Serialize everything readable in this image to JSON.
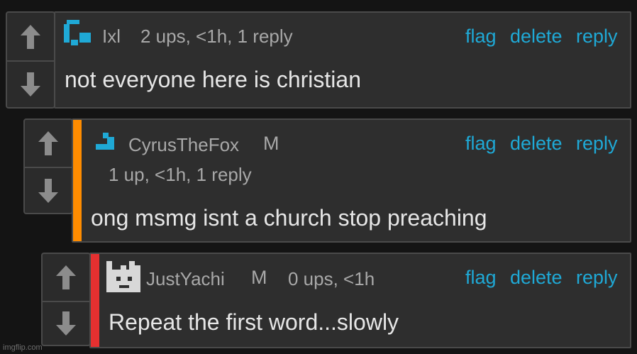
{
  "colors": {
    "background": "#141414",
    "panel": "#2e2e2e",
    "border": "#4a4a4a",
    "link": "#1fa9d6",
    "accent_orange": "#ff8c00",
    "accent_red": "#e53030"
  },
  "comments": [
    {
      "username": "Ixl",
      "avatar_icon": "pixel-avatar-blue-icon",
      "meta": "2 ups, <1h, 1 reply",
      "actions": {
        "flag": "flag",
        "delete": "delete",
        "reply": "reply"
      },
      "text": "not everyone here is christian"
    },
    {
      "username": "CyrusTheFox",
      "mod_badge": "M",
      "avatar_icon": "pixel-avatar-blue-icon",
      "meta": "1 up, <1h, 1 reply",
      "actions": {
        "flag": "flag",
        "delete": "delete",
        "reply": "reply"
      },
      "text": "ong msmg isnt a church stop preaching"
    },
    {
      "username": "JustYachi",
      "mod_badge": "M",
      "avatar_icon": "pixel-avatar-grey-icon",
      "meta": "0 ups, <1h",
      "actions": {
        "flag": "flag",
        "delete": "delete",
        "reply": "reply"
      },
      "text": "Repeat the first word...slowly"
    }
  ],
  "vote_icons": {
    "up": "upvote-arrow-icon",
    "down": "downvote-arrow-icon"
  },
  "watermark": "imgflip.com"
}
